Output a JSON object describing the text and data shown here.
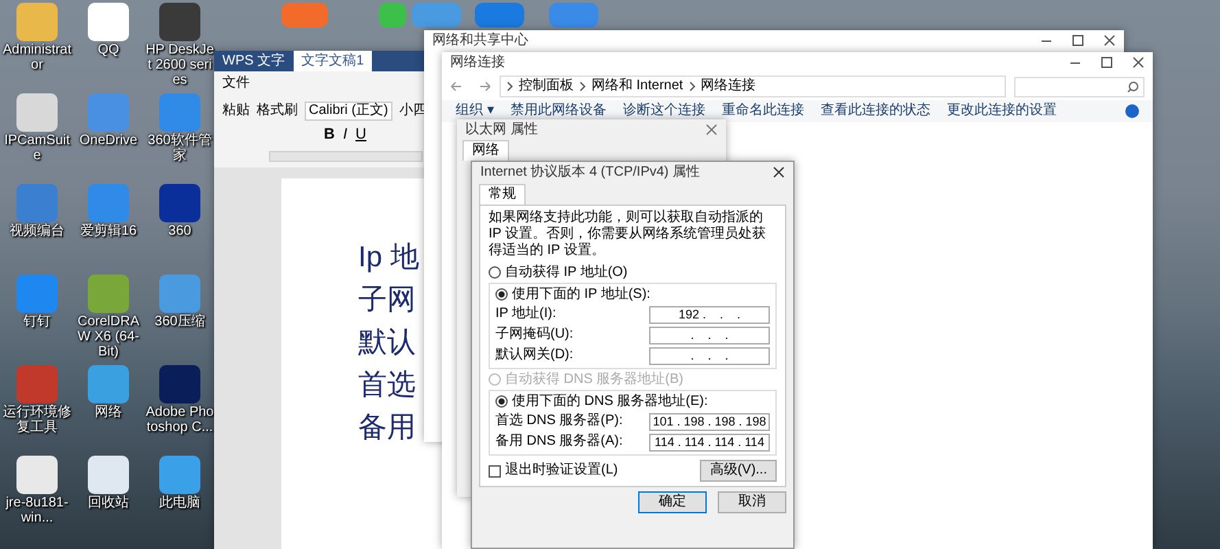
{
  "desktop": {
    "icons": [
      {
        "label": "Administrator"
      },
      {
        "label": "QQ"
      },
      {
        "label": "HP DeskJet 2600 series"
      },
      {
        "label": "IPCamSuite"
      },
      {
        "label": "OneDrive"
      },
      {
        "label": "360软件管家"
      },
      {
        "label": "视频编台"
      },
      {
        "label": "爱剪辑16"
      },
      {
        "label": "360"
      },
      {
        "label": "钉钉"
      },
      {
        "label": "CorelDRAW X6 (64-Bit)"
      },
      {
        "label": "360压缩"
      },
      {
        "label": "运行环境修复工具"
      },
      {
        "label": "网络"
      },
      {
        "label": "Adobe Photoshop C..."
      },
      {
        "label": "jre-8u181-win..."
      },
      {
        "label": "回收站"
      },
      {
        "label": "此电脑"
      }
    ]
  },
  "wps": {
    "tabs": [
      {
        "label": "WPS 文字",
        "selected": false
      },
      {
        "label": "文字文稿1",
        "selected": true
      }
    ],
    "menu": "文件",
    "paste": "粘贴",
    "format_painter": "格式刷",
    "font": "Calibri (正文)",
    "size": "小四",
    "styles": [
      "B",
      "I",
      "U"
    ],
    "document": {
      "lines": [
        "Ip 地",
        "子网",
        "默认",
        "首选",
        "备用"
      ]
    }
  },
  "network_center": {
    "title": "网络和共享中心"
  },
  "connections": {
    "title": "网络连接",
    "breadcrumb": [
      "控制面板",
      "网络和 Internet",
      "网络连接"
    ],
    "toolbar": [
      "组织 ▾",
      "禁用此网络设备",
      "诊断这个连接",
      "重命名此连接",
      "查看此连接的状态",
      "更改此连接的设置"
    ]
  },
  "ethernet": {
    "title": "以太网 属性",
    "tabs": [
      {
        "label": "网络",
        "selected": true
      }
    ]
  },
  "ipv4": {
    "title": "Internet 协议版本 4 (TCP/IPv4) 属性",
    "tabs": [
      {
        "label": "常规",
        "selected": true
      }
    ],
    "description": "如果网络支持此功能，则可以获取自动指派的 IP 设置。否则，你需要从网络系统管理员处获得适当的 IP 设置。",
    "ip_mode": [
      {
        "label": "自动获得 IP 地址(O)",
        "selected": false,
        "disabled": false
      },
      {
        "label": "使用下面的 IP 地址(S):",
        "selected": true,
        "disabled": false
      }
    ],
    "ip_fields": [
      {
        "label": "IP 地址(I):",
        "value": "192 .    .    ."
      },
      {
        "label": "子网掩码(U):",
        "value": ".    .    ."
      },
      {
        "label": "默认网关(D):",
        "value": ".    .    ."
      }
    ],
    "dns_mode": [
      {
        "label": "自动获得 DNS 服务器地址(B)",
        "selected": false,
        "disabled": true
      },
      {
        "label": "使用下面的 DNS 服务器地址(E):",
        "selected": true,
        "disabled": false
      }
    ],
    "dns_fields": [
      {
        "label": "首选 DNS 服务器(P):",
        "value": "101 . 198 . 198 . 198"
      },
      {
        "label": "备用 DNS 服务器(A):",
        "value": "114 . 114 . 114 . 114"
      }
    ],
    "validate": {
      "label": "退出时验证设置(L)",
      "checked": false
    },
    "advanced": "高级(V)...",
    "ok": "确定",
    "cancel": "取消"
  }
}
